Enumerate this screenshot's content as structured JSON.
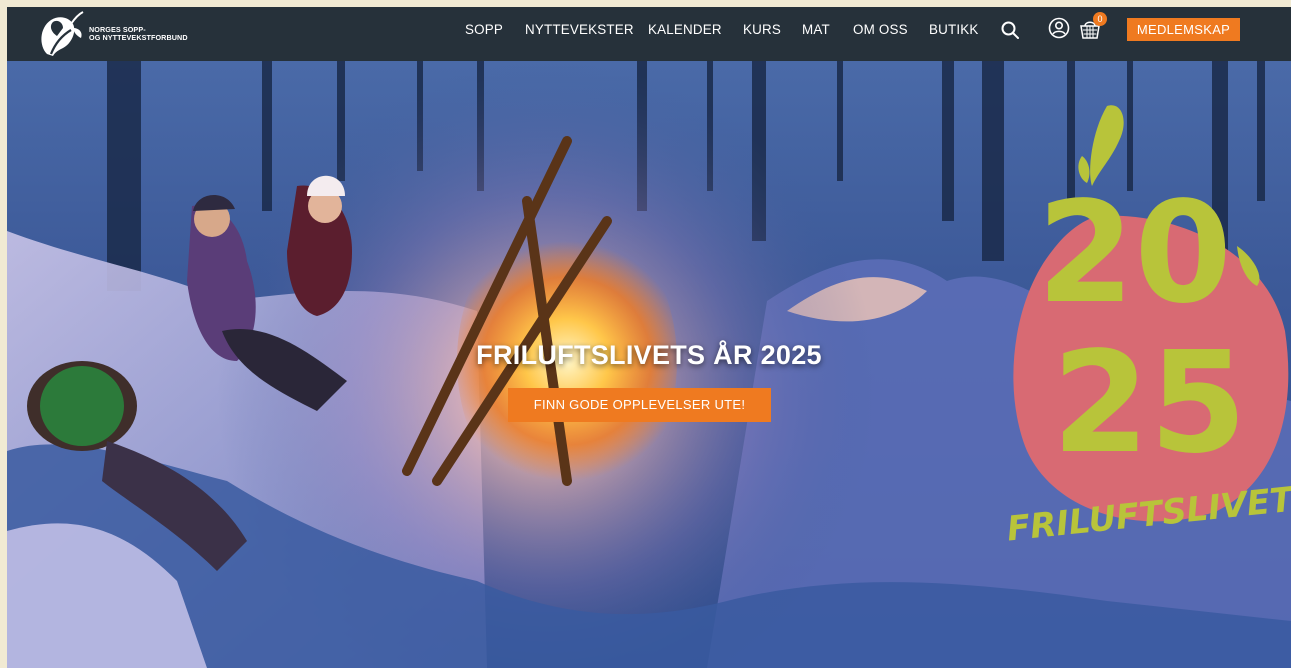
{
  "org": {
    "name_line1": "NORGES SOPP-",
    "name_line2": "OG NYTTEVEKSTFORBUND",
    "logo_icon": "leaf-mushroom-logo"
  },
  "nav": {
    "items": [
      {
        "label": "SOPP"
      },
      {
        "label": "NYTTEVEKSTER"
      },
      {
        "label": "KALENDER"
      },
      {
        "label": "KURS"
      },
      {
        "label": "MAT"
      },
      {
        "label": "OM OSS"
      },
      {
        "label": "BUTIKK"
      }
    ],
    "search_icon": "search-icon",
    "account_icon": "user-icon",
    "cart_icon": "basket-icon",
    "cart_count": "0",
    "member_label": "MEDLEMSKAP"
  },
  "hero": {
    "title": "FRILUFTSLIVETS ÅR 2025",
    "cta_label": "FINN GODE OPPLEVELSER UTE!",
    "badge_year_top": "20",
    "badge_year_bottom": "25",
    "badge_text": "FRILUFTSLIVETS ÅR"
  },
  "colors": {
    "header_bg": "#26313a",
    "accent": "#ef7a20",
    "page_bg": "#f1ead3",
    "badge_pink": "#d86a73",
    "badge_lime": "#b8c43a"
  }
}
